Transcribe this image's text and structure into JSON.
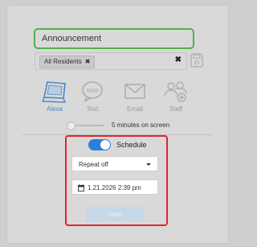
{
  "form": {
    "title_value": "Announcement",
    "recipients": {
      "chips": [
        "All Residents"
      ],
      "chip_remove_glyph": "✖",
      "clear_glyph": "✖"
    }
  },
  "channels": [
    {
      "label": "Alexa",
      "icon": "tablet-icon",
      "selected": true
    },
    {
      "label": "Text",
      "icon": "sms-icon",
      "selected": false
    },
    {
      "label": "Email",
      "icon": "envelope-icon",
      "selected": false
    },
    {
      "label": "Staff",
      "icon": "staff-icon",
      "selected": false
    }
  ],
  "duration": {
    "label": "5 minutes on screen",
    "level": 0
  },
  "schedule": {
    "toggle_on": true,
    "label": "Schedule",
    "repeat_value": "Repeat off",
    "datetime_value": "1.21.2026 2:39 pm",
    "send_label": "Send"
  },
  "colors": {
    "accent": "#2c7fd8",
    "title_border": "#52b04e",
    "highlight": "#e0262b",
    "selected_channel": "#4a86c8",
    "send_disabled": "#c6d7e7"
  }
}
